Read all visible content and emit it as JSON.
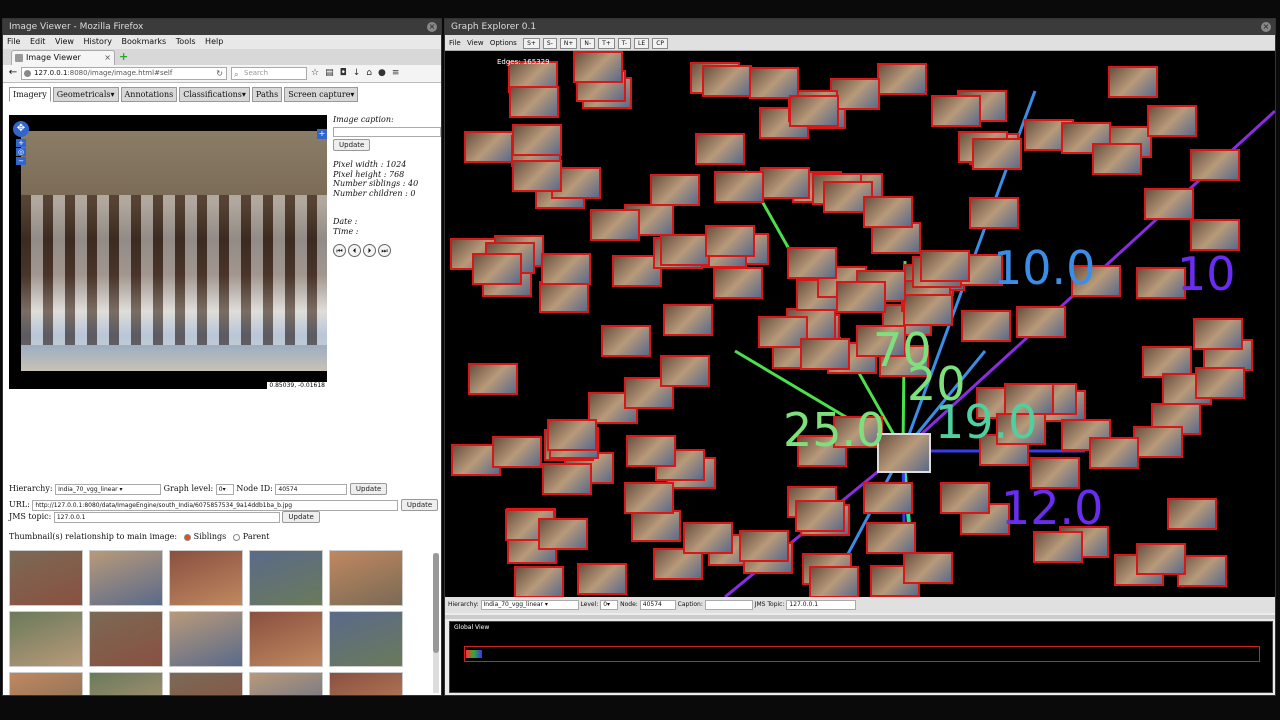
{
  "firefox": {
    "title": "Image Viewer - Mozilla Firefox",
    "menu": [
      "File",
      "Edit",
      "View",
      "History",
      "Bookmarks",
      "Tools",
      "Help"
    ],
    "tab_title": "Image Viewer",
    "url_host": "127.0.0.1",
    "url_path": ":8080/image/image.html#self",
    "search_placeholder": "Search",
    "page_tabs": [
      "Imagery",
      "Geometricals▾",
      "Annotations",
      "Classifications▾",
      "Paths",
      "Screen capture▾"
    ],
    "coords": "0.85039, -0.01618",
    "caption_label": "Image caption:",
    "update": "Update",
    "pixel_width": "Pixel width : 1024",
    "pixel_height": "Pixel height : 768",
    "siblings": "Number siblings : 40",
    "children": "Number children : 0",
    "date": "Date :",
    "time": "Time :",
    "media": [
      "⏮",
      "⏴",
      "⏵",
      "⏭"
    ],
    "hierarchy_label": "Hierarchy:",
    "hierarchy_value": "India_70_vgg_linear",
    "graph_level_label": "Graph level:",
    "graph_level_value": "0",
    "node_id_label": "Node ID:",
    "node_id_value": "40574",
    "url_label": "URL:",
    "url_value": "http://127.0.0.1:8080/data/ImageEngine/south_India/6075857534_9a14ddb1ba_b.jpg",
    "jms_label": "JMS topic:",
    "jms_value": "127.0.0.1",
    "thumb_label": "Thumbnail(s) relationship to main image:",
    "siblings_opt": "Siblings",
    "parent_opt": "Parent"
  },
  "graph_explorer": {
    "title": "Graph Explorer 0.1",
    "menu": [
      "File",
      "View",
      "Options"
    ],
    "toolbar": [
      "S+",
      "S-",
      "N+",
      "N-",
      "T+",
      "T-",
      "LE",
      "CP"
    ],
    "edges": "Edges: 165329",
    "edge_labels": [
      "10.0",
      "70",
      "20",
      "25.0",
      "19.0",
      "12.0",
      "10"
    ],
    "edge_label_colors": [
      "#3a8ee8",
      "#7de07d",
      "#7de07d",
      "#7de07d",
      "#4fd0a0",
      "#6a2cf0",
      "#3a8ee8"
    ],
    "hierarchy_label": "Hierarchy:",
    "hierarchy_value": "India_70_vgg_linear",
    "level_label": "Level:",
    "level_value": "0",
    "node_label": "Node:",
    "node_value": "40574",
    "caption_label": "Caption:",
    "caption_value": "",
    "jms_label": "JMS Topic:",
    "jms_value": "127.0.0.1",
    "global_view": "Global View"
  }
}
